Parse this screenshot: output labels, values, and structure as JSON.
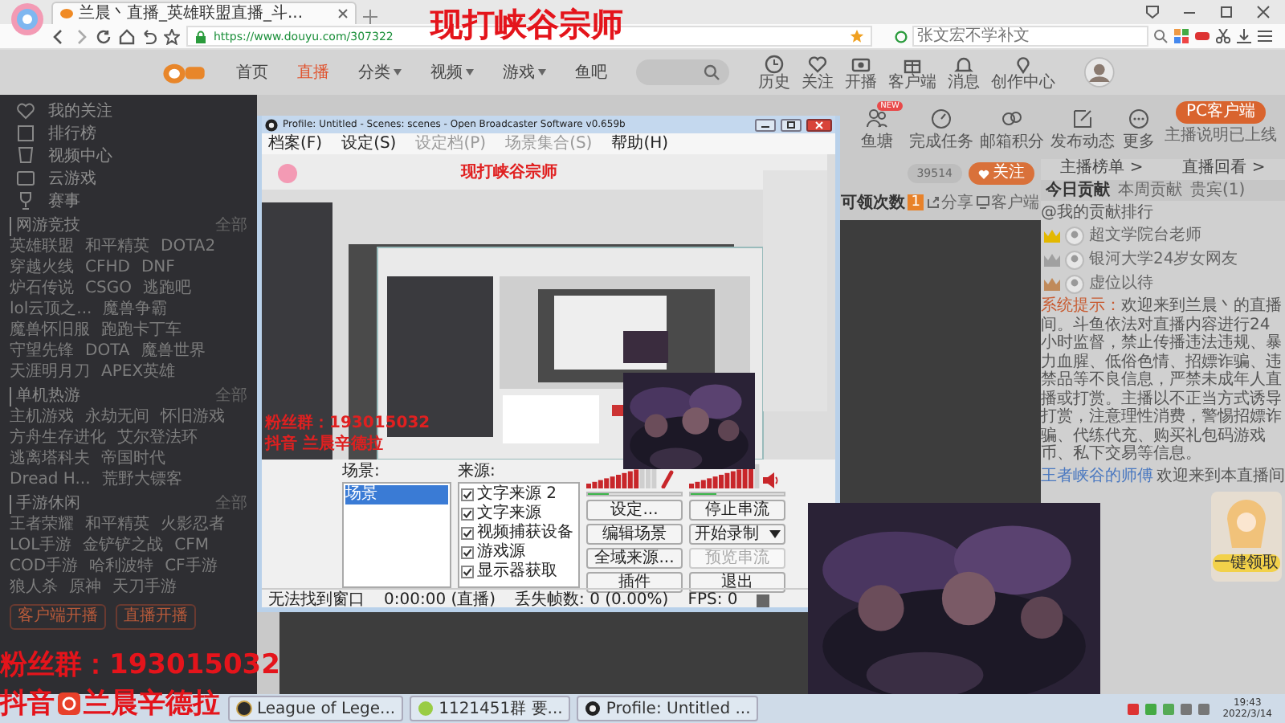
{
  "browser": {
    "tab_title": "兰晨丶直播_英雄联盟直播_斗...",
    "url": "https://www.douyu.com/307322",
    "search_placeholder": "张文宏不学补文"
  },
  "overlay": {
    "title": "现打峡谷宗师",
    "fan_group": "粉丝群：193015032",
    "douyin_label": "抖音",
    "douyin_name": "兰晨辛德拉"
  },
  "site": {
    "nav": [
      {
        "label": "首页",
        "selected": false,
        "has_menu": false
      },
      {
        "label": "直播",
        "selected": true,
        "has_menu": false
      },
      {
        "label": "分类",
        "selected": false,
        "has_menu": true
      },
      {
        "label": "视频",
        "selected": false,
        "has_menu": true
      },
      {
        "label": "游戏",
        "selected": false,
        "has_menu": true
      },
      {
        "label": "鱼吧",
        "selected": false,
        "has_menu": false
      }
    ],
    "header_icons": [
      {
        "kind": "clock",
        "label": "历史"
      },
      {
        "kind": "heart",
        "label": "关注"
      },
      {
        "kind": "camera",
        "label": "开播"
      },
      {
        "kind": "gift",
        "label": "客户端"
      },
      {
        "kind": "bell",
        "label": "消息"
      },
      {
        "kind": "pin",
        "label": "创作中心"
      }
    ]
  },
  "sidebar": {
    "items": [
      "我的关注",
      "排行榜",
      "视频中心",
      "云游戏",
      "赛事"
    ],
    "sections": [
      {
        "title": "网游竞技",
        "more": "全部",
        "games": [
          "英雄联盟",
          "和平精英",
          "DOTA2",
          "穿越火线",
          "CFHD",
          "DNF",
          "炉石传说",
          "CSGO",
          "逃跑吧",
          "lol云顶之...",
          "魔兽争霸",
          "魔兽怀旧服",
          "跑跑卡丁车",
          "守望先锋",
          "DOTA",
          "魔兽世界",
          "天涯明月刀",
          "APEX英雄"
        ]
      },
      {
        "title": "单机热游",
        "more": "全部",
        "games": [
          "主机游戏",
          "永劫无间",
          "怀旧游戏",
          "方舟生存进化",
          "艾尔登法环",
          "逃离塔科夫",
          "帝国时代",
          "Dread H...",
          "荒野大镖客"
        ]
      },
      {
        "title": "手游休闲",
        "more": "全部",
        "games": [
          "王者荣耀",
          "和平精英",
          "火影忍者",
          "LOL手游",
          "金铲铲之战",
          "CFM",
          "COD手游",
          "哈利波特",
          "CF手游",
          "狼人杀",
          "原神",
          "天刀手游"
        ]
      }
    ],
    "buttons": [
      "客户端开播",
      "直播开播"
    ]
  },
  "room": {
    "tools": [
      {
        "kind": "people",
        "label": "鱼塘",
        "badge": "NEW"
      },
      {
        "kind": "gauge",
        "label": "完成任务"
      },
      {
        "kind": "link",
        "label": "邮箱积分"
      },
      {
        "kind": "edit",
        "label": "发布动态"
      },
      {
        "kind": "more",
        "label": "更多"
      }
    ],
    "follow_count": "39514",
    "follow_label": "关注",
    "claim_label": "可领次数",
    "claim_count": "1",
    "share": "分享",
    "client": "客户端"
  },
  "right_panel": {
    "pc_button": "PC客户端",
    "pc_note": "主播说明已上线",
    "links": [
      "主播榜单 >",
      "直播回看 >"
    ],
    "tabs": [
      {
        "label": "今日贡献",
        "selected": true
      },
      {
        "label": "本周贡献",
        "selected": false
      },
      {
        "label": "贵宾(1)",
        "selected": false
      }
    ],
    "rank_title": "@我的贡献排行",
    "ranks": [
      {
        "name": "超文学院台老师",
        "color": "#e3b800"
      },
      {
        "name": "银河大学24岁女网友",
        "color": "#a0a0a0"
      },
      {
        "name": "虚位以待",
        "color": "#c08a5a"
      }
    ],
    "notice_label": "系统提示：",
    "notice": "欢迎来到兰晨丶的直播间。斗鱼依法对直播内容进行24小时监督，禁止传播违法违规、暴力血腥、低俗色情、招嫖诈骗、违禁品等不良信息，严禁未成年人直播或打赏。主播以不正当方式诱导打赏，注意理性消费，警惕招嫖诈骗、代练代充、购买礼包码游戏币、私下交易等信息。",
    "welcome_user": "王者峡谷的师傅",
    "welcome_text": "欢迎来到本直播间",
    "ad_button": "一键领取"
  },
  "obs": {
    "title": "Profile: Untitled - Scenes: scenes - Open Broadcaster Software v0.659b",
    "menu": [
      {
        "label": "档案(F)",
        "disabled": false
      },
      {
        "label": "设定(S)",
        "disabled": false
      },
      {
        "label": "设定档(P)",
        "disabled": true
      },
      {
        "label": "场景集合(S)",
        "disabled": true
      },
      {
        "label": "帮助(H)",
        "disabled": false
      }
    ],
    "preview": {
      "title": "现打峡谷宗师",
      "fan_group": "粉丝群：193015032",
      "douyin": "抖音 兰晨辛德拉"
    },
    "scenes_label": "场景:",
    "scenes": [
      {
        "label": "场景",
        "selected": true
      }
    ],
    "sources_label": "来源:",
    "sources": [
      {
        "label": "文字来源 2",
        "checked": true
      },
      {
        "label": "文字来源",
        "checked": true
      },
      {
        "label": "视频捕获设备",
        "checked": true
      },
      {
        "label": "游戏源",
        "checked": true
      },
      {
        "label": "显示器获取",
        "checked": true
      }
    ],
    "meters": [
      {
        "kind": "mic",
        "level": 0.75
      },
      {
        "kind": "speaker",
        "level": 0.9
      }
    ],
    "buttons": [
      {
        "label": "设定...",
        "disabled": false,
        "menu": false
      },
      {
        "label": "停止串流",
        "disabled": false,
        "menu": false
      },
      {
        "label": "编辑场景",
        "disabled": false,
        "menu": false
      },
      {
        "label": "开始录制",
        "disabled": false,
        "menu": true
      },
      {
        "label": "全域来源...",
        "disabled": false,
        "menu": false
      },
      {
        "label": "预览串流",
        "disabled": true,
        "menu": false
      },
      {
        "label": "插件",
        "disabled": false,
        "menu": false
      },
      {
        "label": "退出",
        "disabled": false,
        "menu": false
      }
    ],
    "status": [
      "无法找到窗口",
      "0:00:00 (直播)",
      "丢失帧数: 0 (0.00%)",
      "FPS: 0"
    ]
  },
  "taskbar": {
    "tasks": [
      {
        "kind": "lol",
        "label": "League of Lege..."
      },
      {
        "kind": "qq",
        "label": "1121451群 要..."
      },
      {
        "kind": "obs",
        "label": "Profile: Untitled ..."
      }
    ],
    "time": "19:43",
    "date": "2022/3/14"
  }
}
